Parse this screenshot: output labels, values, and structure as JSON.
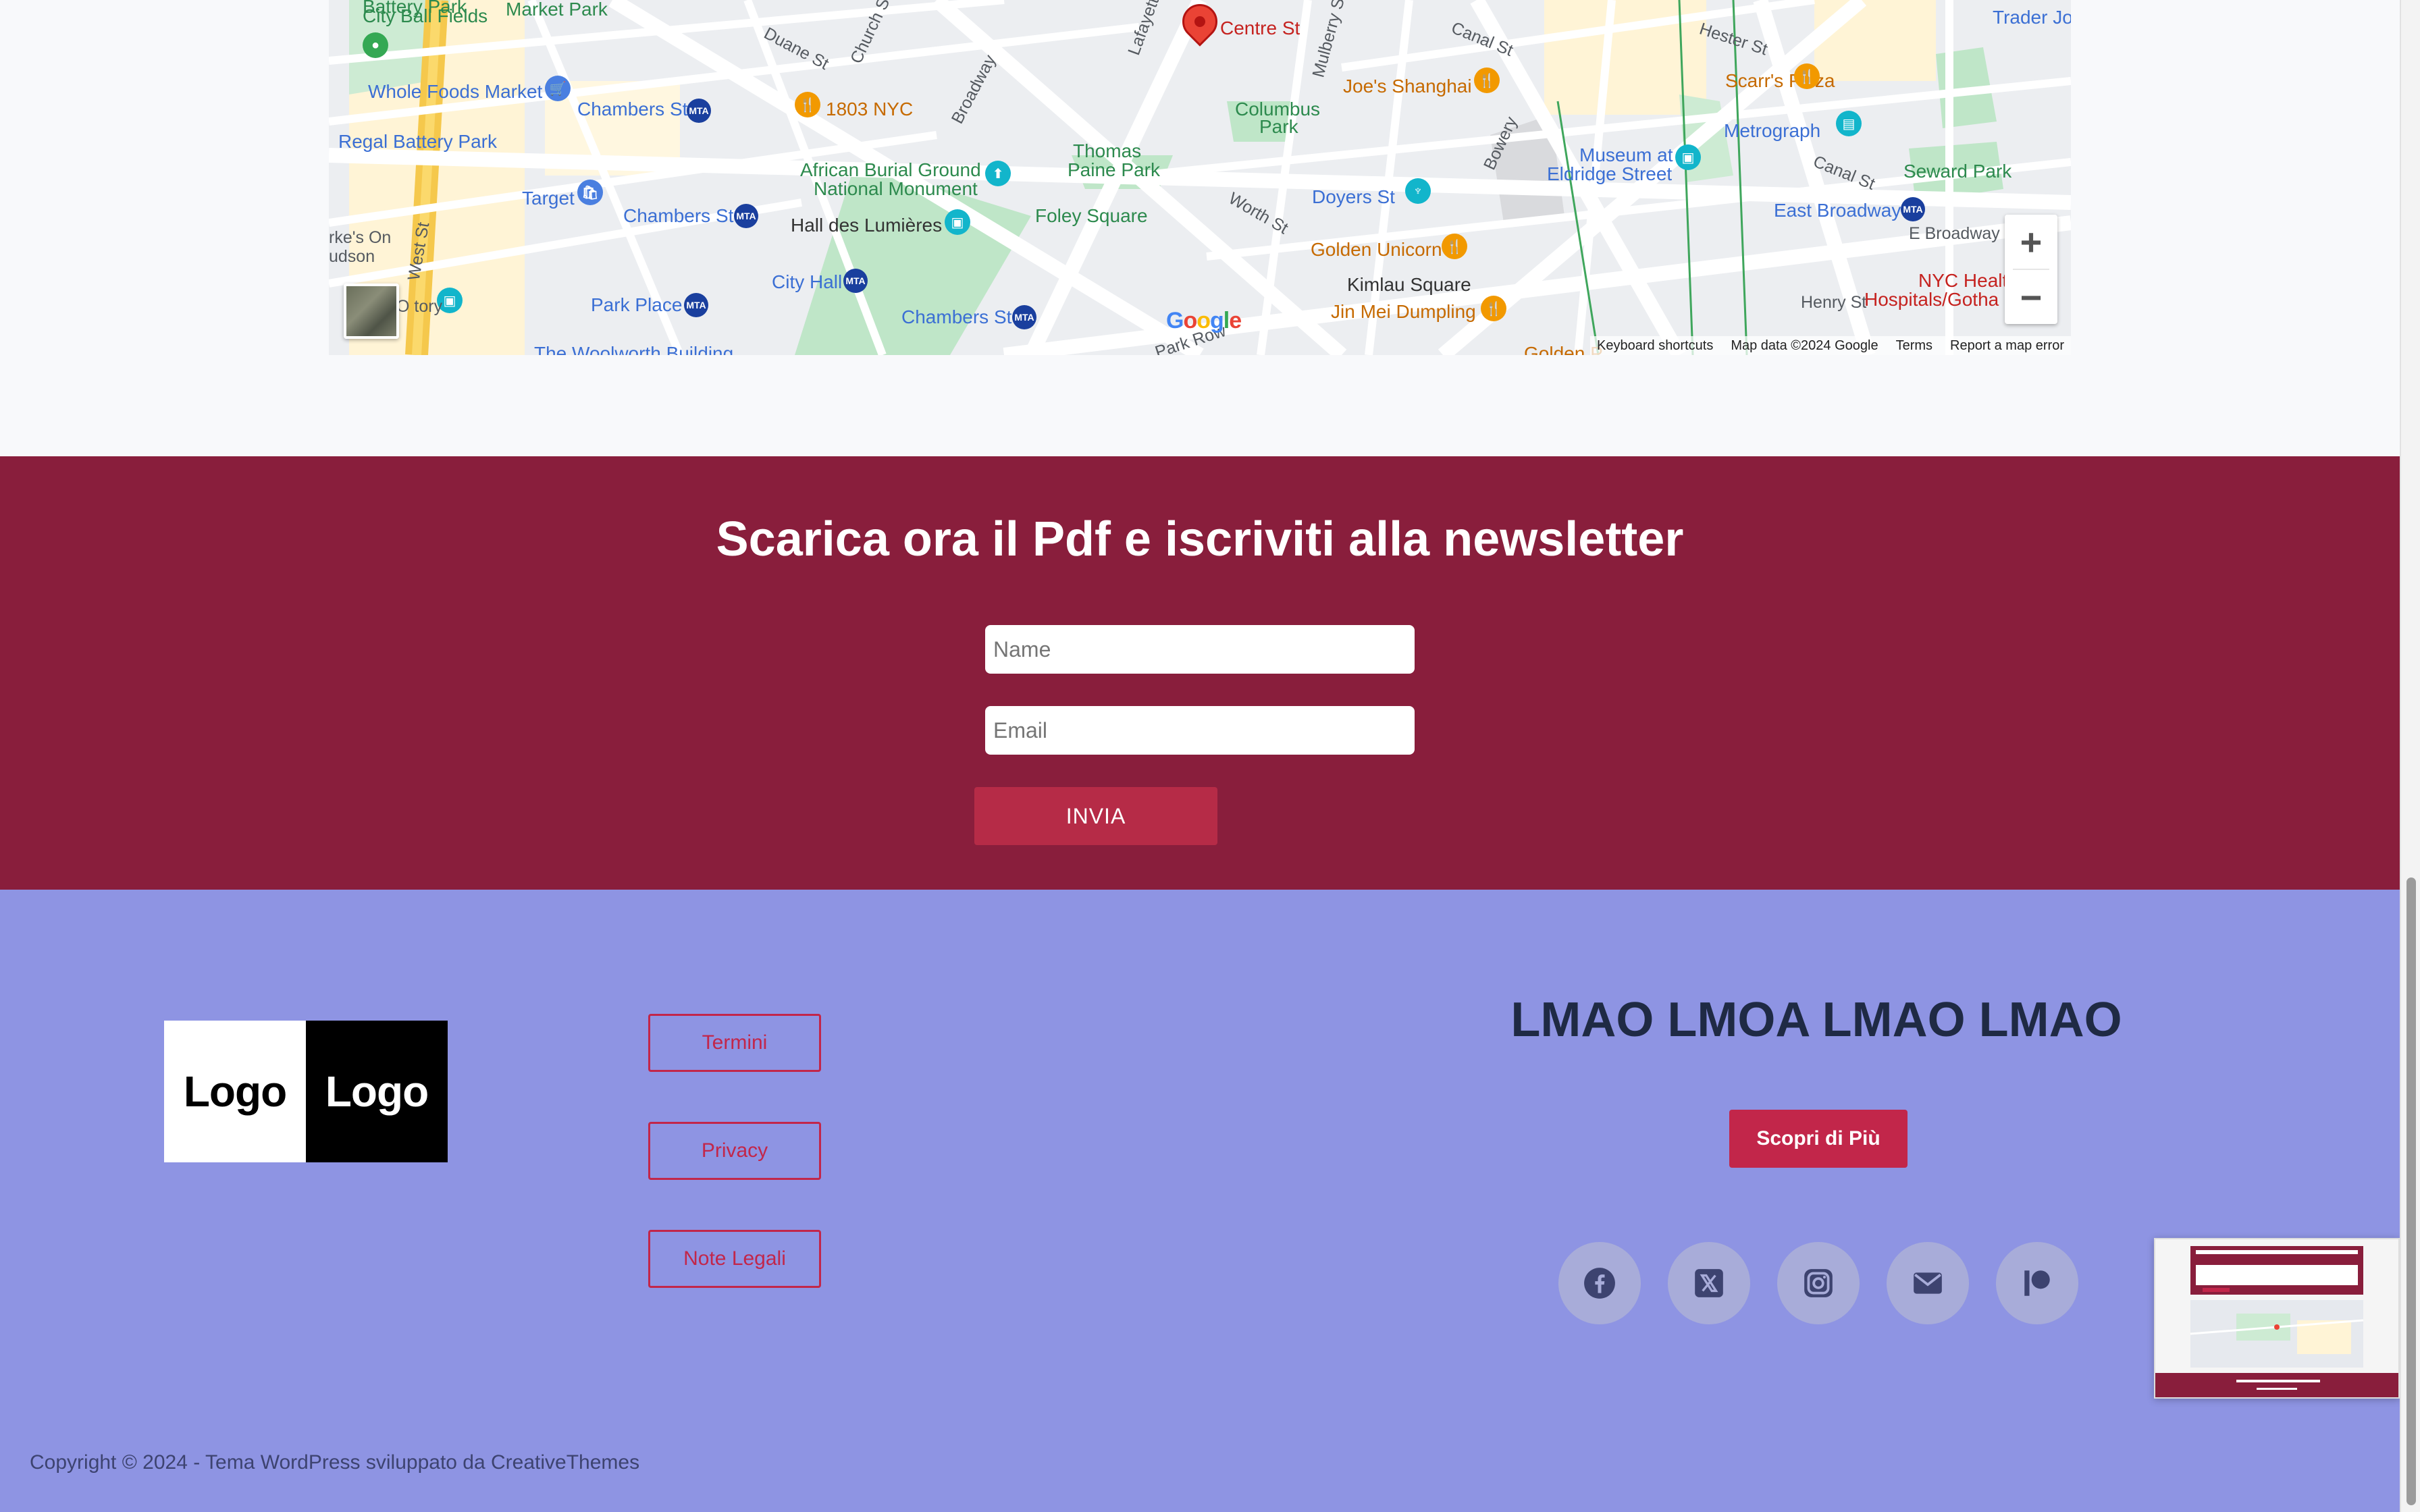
{
  "map": {
    "pin_label": "Centre St",
    "google_logo": "Google",
    "footer": {
      "shortcuts": "Keyboard shortcuts",
      "map_data": "Map data ©2024 Google",
      "terms": "Terms",
      "report": "Report a map error"
    },
    "labels": {
      "battery_park": "Battery Park",
      "city_ball": "City Ball Fields",
      "market_park": "Market Park",
      "whole_foods": "Whole Foods Market",
      "chambers_st_1": "Chambers St",
      "nyc_1803": "1803 NYC",
      "regal": "Regal Battery Park",
      "target": "Target",
      "chambers_st_2": "Chambers St",
      "african_burial_1": "African Burial Ground",
      "african_burial_2": "National Monument",
      "thomas_paine_1": "Thomas",
      "thomas_paine_2": "Paine Park",
      "foley": "Foley Square",
      "hall_lumieres": "Hall des Lumières",
      "columbus_1": "Columbus",
      "columbus_2": "Park",
      "joes": "Joe's Shanghai",
      "scarrs": "Scarr's Pizza",
      "metrograph": "Metrograph",
      "museum_1": "Museum at",
      "museum_2": "Eldridge Street",
      "seward": "Seward Park",
      "east_broadway": "East Broadway",
      "e_broadway": "E Broadway",
      "doyers": "Doyers St",
      "golden_unicorn": "Golden Unicorn",
      "kimlau": "Kimlau Square",
      "jin_mei": "Jin Mei Dumpling",
      "city_hall": "City Hall",
      "chambers_st_3": "Chambers St",
      "park_place": "Park Place",
      "woolworth": "The Woolworth Building",
      "henry_st": "Henry St",
      "nyc_health_1": "NYC Healt",
      "nyc_health_2": "Hospitals/Gotha",
      "trader_jo": "Trader Jo",
      "west_st": "West St",
      "duane_st": "Duane St",
      "church_st": "Church St",
      "broadway": "Broadway",
      "lafayette": "Lafayette",
      "mulberry": "Mulberry St",
      "canal_st_1": "Canal St",
      "canal_st_2": "Canal St",
      "bowery": "Bowery",
      "hester": "Hester St",
      "worth_st": "Worth St",
      "park_row": "Park Row",
      "rkes_on": "rke's On",
      "udson": "udson",
      "o_tory": "O     tory",
      "golden_p": "Golden P"
    },
    "zoom_in": "+",
    "zoom_out": "−"
  },
  "newsletter": {
    "title": "Scarica ora il Pdf e iscriviti alla newsletter",
    "name_placeholder": "Name",
    "email_placeholder": "Email",
    "submit_label": "INVIA"
  },
  "footer": {
    "logo_left": "Logo",
    "logo_right": "Logo",
    "links": [
      "Termini",
      "Privacy",
      "Note Legali"
    ],
    "heading": "LMAO LMOA LMAO LMAO",
    "cta_label": "Scopri di Più",
    "social": [
      "facebook-icon",
      "x-icon",
      "instagram-icon",
      "email-icon",
      "patreon-icon"
    ],
    "copyright": "Copyright © 2024 - Tema WordPress sviluppato da CreativeThemes"
  },
  "colors": {
    "newsletter_bg": "#891e3c",
    "footer_bg": "#8e94e3",
    "accent": "#c2264a"
  }
}
